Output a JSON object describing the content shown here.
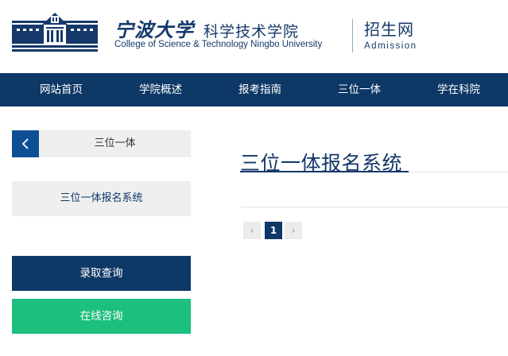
{
  "header": {
    "university_cn": "宁波大学",
    "school_cn": "科学技术学院",
    "school_en": "College of Science & Technology Ningbo University",
    "section_cn": "招生网",
    "section_en": "Admission"
  },
  "nav": {
    "items": [
      {
        "label": "网站首页"
      },
      {
        "label": "学院概述"
      },
      {
        "label": "报考指南"
      },
      {
        "label": "三位一体"
      },
      {
        "label": "学在科院"
      }
    ]
  },
  "sidebar": {
    "heading": "三位一体",
    "back_icon": "chevron-left-icon",
    "links": [
      {
        "label": "三位一体报名系统"
      }
    ],
    "query_button": "录取查询",
    "consult_button": "在线咨询"
  },
  "main": {
    "title": "三位一体报名系统"
  },
  "pagination": {
    "prev_symbol": "‹",
    "current_page": "1",
    "next_symbol": "›"
  },
  "colors": {
    "brand_navy": "#0e3866",
    "back_button_blue": "#0e4f94",
    "consult_green": "#1cbf7e",
    "panel_gray": "#efefef"
  }
}
